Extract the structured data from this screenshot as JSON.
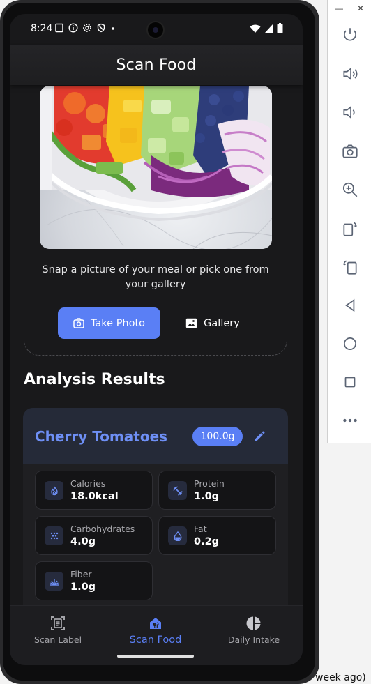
{
  "status": {
    "time": "8:24"
  },
  "appbar": {
    "title": "Scan Food"
  },
  "scan": {
    "hint": "Snap a picture of your meal or pick one from your gallery",
    "take_photo_label": "Take Photo",
    "gallery_label": "Gallery"
  },
  "results": {
    "section_title": "Analysis Results",
    "food_name": "Cherry Tomatoes",
    "weight": "100.0g",
    "nutrients": [
      {
        "label": "Calories",
        "value": "18.0kcal",
        "icon": "flame-icon"
      },
      {
        "label": "Protein",
        "value": "1.0g",
        "icon": "dumbbell-icon"
      },
      {
        "label": "Carbohydrates",
        "value": "4.0g",
        "icon": "grain-icon"
      },
      {
        "label": "Fat",
        "value": "0.2g",
        "icon": "drop-icon"
      },
      {
        "label": "Fiber",
        "value": "1.0g",
        "icon": "grass-icon"
      }
    ]
  },
  "nav": {
    "items": [
      {
        "label": "Scan Label",
        "icon": "document-scanner-icon"
      },
      {
        "label": "Scan Food",
        "icon": "restaurant-icon"
      },
      {
        "label": "Daily Intake",
        "icon": "pie-chart-icon"
      }
    ],
    "active": "Scan Food"
  },
  "desktop": {
    "bottom_text": "week ago)"
  },
  "colors": {
    "accent": "#5a7ff5",
    "food_name": "#6e8ff5",
    "background": "#19191b",
    "card": "#1f1f22"
  }
}
